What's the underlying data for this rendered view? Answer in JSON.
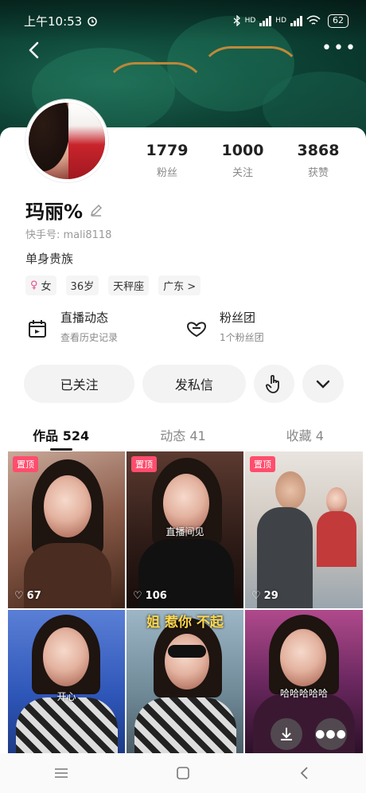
{
  "status": {
    "time": "上午10:53",
    "network_1": "HD",
    "network_2": "HD",
    "battery": "62"
  },
  "profile": {
    "name": "玛丽%",
    "kuaishou_id": "快手号: mali8118",
    "bio": "单身贵族",
    "stats": [
      {
        "num": "1779",
        "label": "粉丝"
      },
      {
        "num": "1000",
        "label": "关注"
      },
      {
        "num": "3868",
        "label": "获赞"
      }
    ],
    "tags": {
      "gender": "女",
      "age": "36岁",
      "zodiac": "天秤座",
      "region": "广东 >"
    }
  },
  "features": [
    {
      "title": "直播动态",
      "sub": "查看历史记录",
      "icon": "calendar-icon"
    },
    {
      "title": "粉丝团",
      "sub": "1个粉丝团",
      "icon": "heart-badge-icon"
    }
  ],
  "actions": {
    "follow": "已关注",
    "message": "发私信"
  },
  "tabs": [
    "作品 524",
    "动态 41",
    "收藏 4"
  ],
  "videos": [
    {
      "pinned": "置顶",
      "likes": "67",
      "caption": ""
    },
    {
      "pinned": "置顶",
      "likes": "106",
      "caption": "直播间见"
    },
    {
      "pinned": "置顶",
      "likes": "29",
      "caption": ""
    },
    {
      "pinned": "",
      "likes": "",
      "caption": "开心"
    },
    {
      "pinned": "",
      "likes": "",
      "caption": "姐 惹你 不起"
    },
    {
      "pinned": "",
      "likes": "",
      "caption": "哈哈哈哈哈"
    }
  ],
  "colors": {
    "accent": "#ff4d6d",
    "cover": "#0f4a3a",
    "trim": "#c08a3a"
  }
}
